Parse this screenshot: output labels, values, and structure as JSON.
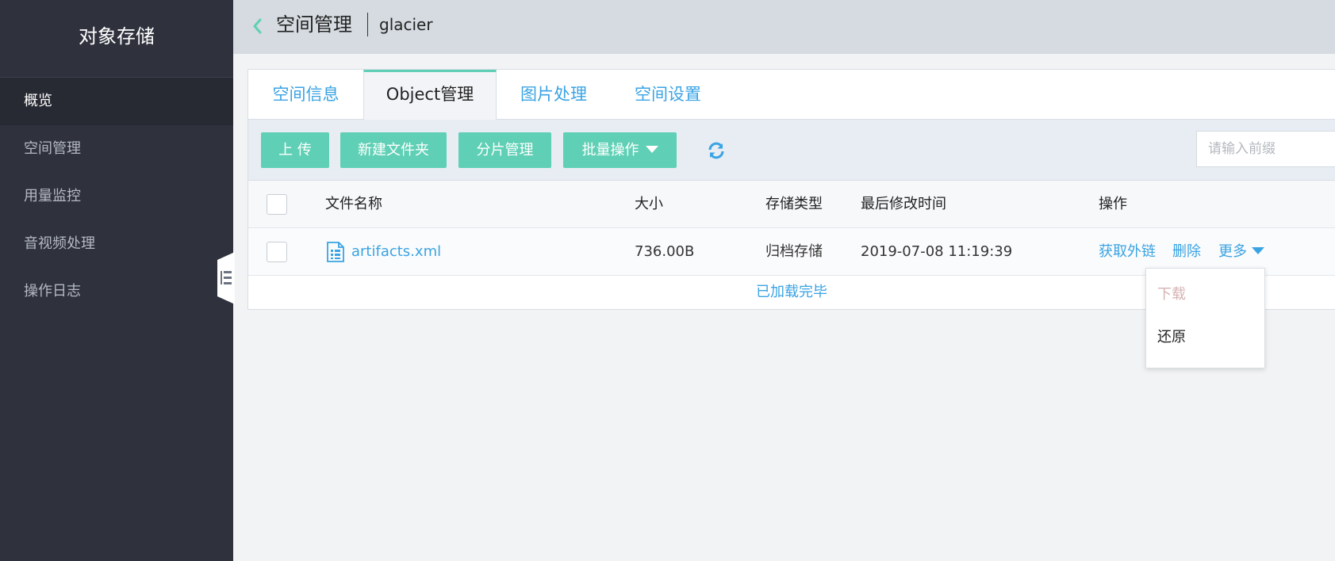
{
  "sidebar": {
    "title": "对象存储",
    "items": [
      {
        "label": "概览",
        "active": true
      },
      {
        "label": "空间管理",
        "active": false
      },
      {
        "label": "用量监控",
        "active": false
      },
      {
        "label": "音视频处理",
        "active": false
      },
      {
        "label": "操作日志",
        "active": false
      }
    ]
  },
  "header": {
    "title": "空间管理",
    "bucket": "glacier"
  },
  "tabs": [
    {
      "label": "空间信息",
      "active": false
    },
    {
      "label": "Object管理",
      "active": true
    },
    {
      "label": "图片处理",
      "active": false
    },
    {
      "label": "空间设置",
      "active": false
    }
  ],
  "toolbar": {
    "upload_label": "上 传",
    "new_folder_label": "新建文件夹",
    "multipart_label": "分片管理",
    "batch_label": "批量操作",
    "search_placeholder": "请输入前缀",
    "search_value": ""
  },
  "table": {
    "columns": [
      "文件名称",
      "大小",
      "存储类型",
      "最后修改时间",
      "操作"
    ],
    "rows": [
      {
        "name": "artifacts.xml",
        "size": "736.00B",
        "storage_type": "归档存储",
        "modified": "2019-07-08 11:19:39",
        "actions": {
          "get_link": "获取外链",
          "delete": "删除",
          "more": "更多"
        }
      }
    ],
    "footer": "已加载完毕"
  },
  "more_menu": {
    "items": [
      {
        "label": "下载",
        "disabled": true
      },
      {
        "label": "还原",
        "disabled": false
      }
    ]
  },
  "colors": {
    "accent": "#5fd0b5",
    "link": "#3aa3e3",
    "sidebar_bg": "#2f323d"
  }
}
